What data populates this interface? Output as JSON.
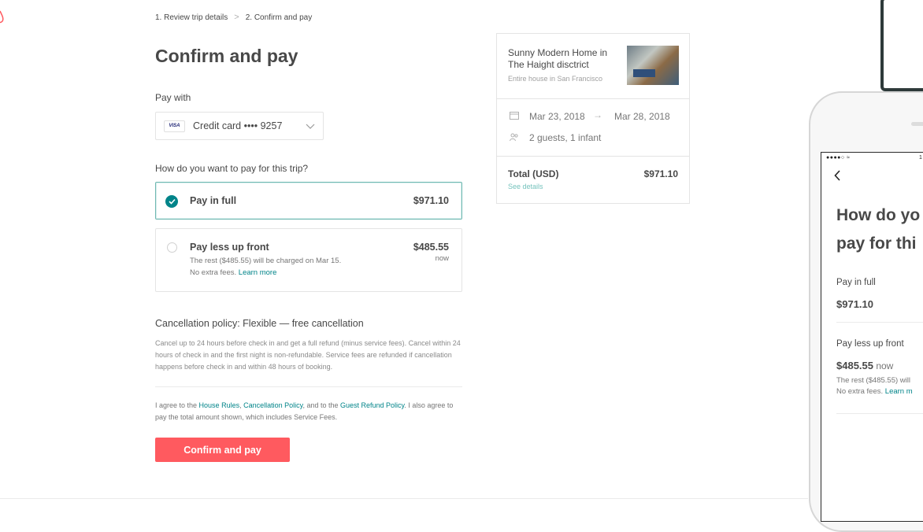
{
  "breadcrumb": {
    "step1": "1. Review trip details",
    "separator": ">",
    "step2": "2. Confirm and pay"
  },
  "page_title": "Confirm and pay",
  "payment": {
    "label": "Pay with",
    "card_brand": "VISA",
    "selected_method": "Credit card •••• 9257"
  },
  "plan": {
    "question": "How do you want to pay for this trip?",
    "options": [
      {
        "title": "Pay in full",
        "price": "$971.10",
        "selected": true
      },
      {
        "title": "Pay less up front",
        "price": "$485.55",
        "price_suffix": "now",
        "sub_line1": "The rest ($485.55) will be charged on Mar 15.",
        "sub_line2_prefix": "No extra fees. ",
        "sub_line2_link": "Learn more",
        "selected": false
      }
    ]
  },
  "cancellation": {
    "title": "Cancellation policy: Flexible — free cancellation",
    "text": "Cancel up to 24 hours before check in and get a full refund (minus service fees). Cancel within 24 hours of check in and the first night is non-refundable. Service fees are refunded if cancellation happens before check in and within 48 hours of booking."
  },
  "agreement": {
    "prefix": "I agree to the ",
    "link1": "House Rules",
    "sep1": ", ",
    "link2": "Cancellation Policy",
    "sep2": ", and to the ",
    "link3": "Guest Refund Policy",
    "suffix": ". I also agree to pay the total amount shown, which includes Service Fees."
  },
  "confirm_button": "Confirm and pay",
  "summary": {
    "listing_title": "Sunny Modern Home in The Haight disctrict",
    "listing_subtitle": "Entire house in San Francisco",
    "check_in": "Mar 23, 2018",
    "arrow": "→",
    "check_out": "Mar 28, 2018",
    "guests": "2 guests, 1 infant",
    "total_label": "Total (USD)",
    "total_value": "$971.10",
    "see_details": "See details"
  },
  "mobile": {
    "status_left": "●●●●○ ≈",
    "status_right": "1",
    "back": "<",
    "heading_line1": "How do yo",
    "heading_line2": "pay for thi",
    "option1_title": "Pay in full",
    "option1_price": "$971.10",
    "option2_title": "Pay less up front",
    "option2_price": "$485.55",
    "option2_now": " now",
    "option2_sub1": "The rest ($485.55) will",
    "option2_sub2_prefix": "No extra fees. ",
    "option2_sub2_link": "Learn m"
  },
  "colors": {
    "brand": "#ff5a5f",
    "accent": "#008489",
    "text": "#484848",
    "muted": "#767676"
  },
  "icons": [
    "airbnb-logo-icon",
    "visa-card-icon",
    "chevron-down-icon",
    "check-icon",
    "calendar-icon",
    "guests-icon",
    "back-arrow-icon"
  ]
}
